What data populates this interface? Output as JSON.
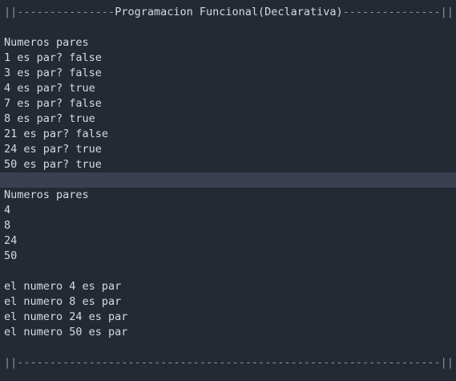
{
  "header_line": {
    "left_bars": "||",
    "left_dashes": "---------------",
    "title": "Programacion Funcional(Declarativa)",
    "right_dashes": "---------------",
    "right_bars": "||"
  },
  "section1": {
    "heading": "Numeros pares",
    "lines": [
      "1 es par? false",
      "3 es par? false",
      "4 es par? true",
      "7 es par? false",
      "8 es par? true",
      "21 es par? false",
      "24 es par? true",
      "50 es par? true"
    ]
  },
  "section2": {
    "heading": "Numeros pares",
    "lines": [
      "4",
      "8",
      "24",
      "50"
    ]
  },
  "section3": {
    "lines": [
      "el numero 4 es par",
      "el numero 8 es par",
      "el numero 24 es par",
      "el numero 50 es par"
    ]
  },
  "footer_line": {
    "left_bars": "||",
    "dashes": "-----------------------------------------------------------------",
    "right_bars": "||"
  }
}
